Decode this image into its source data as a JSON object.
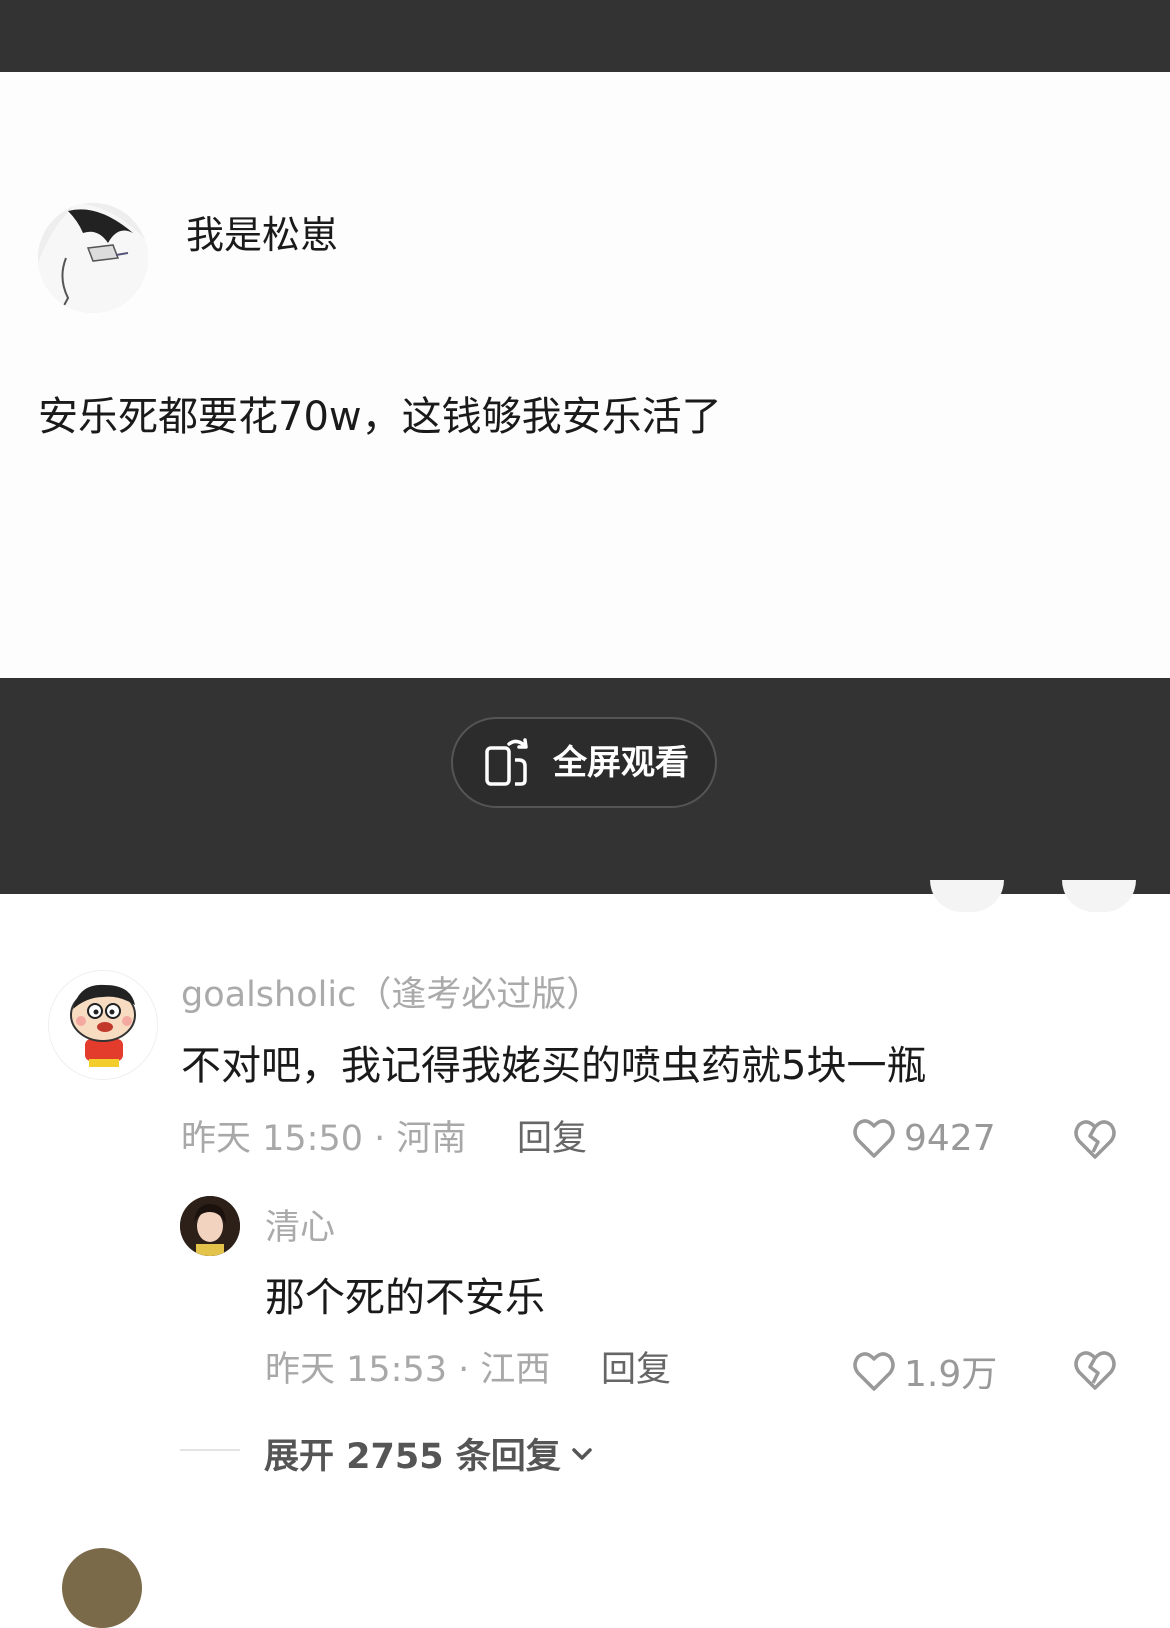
{
  "post": {
    "author": "我是松崽",
    "text": "安乐死都要花70w，这钱够我安乐活了"
  },
  "video": {
    "fullscreen_label": "全屏观看"
  },
  "comments": [
    {
      "user": "goalsholic（逢考必过版）",
      "text": "不对吧，我记得我姥买的喷虫药就5块一瓶",
      "meta": "昨天 15:50 · 河南",
      "reply_label": "回复",
      "likes": "9427",
      "reply": {
        "user": "清心",
        "text": "那个死的不安乐",
        "meta": "昨天 15:53 · 江西",
        "reply_label": "回复",
        "likes": "1.9万"
      },
      "expand_label": "展开 2755 条回复"
    }
  ],
  "colors": {
    "dark_bar": "#333333",
    "heart_outline": "#999999"
  }
}
